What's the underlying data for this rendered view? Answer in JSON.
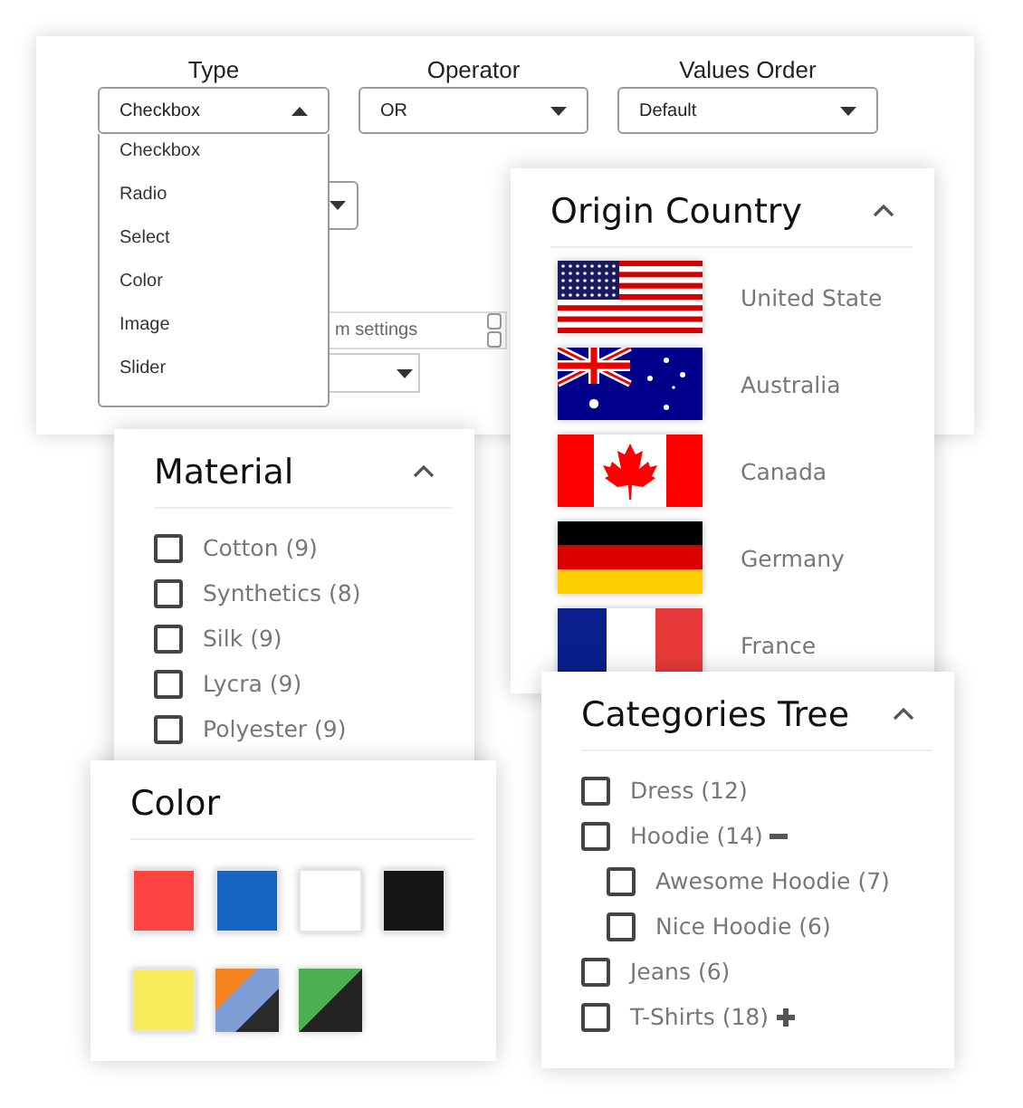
{
  "settings": {
    "fields": [
      {
        "label": "Type",
        "value": "Checkbox",
        "open": true,
        "options": [
          "Checkbox",
          "Radio",
          "Select",
          "Color",
          "Image",
          "Slider"
        ]
      },
      {
        "label": "Operator",
        "value": "OR",
        "open": false
      },
      {
        "label": "Values Order",
        "value": "Default",
        "open": false
      }
    ],
    "covered_fields": [
      {
        "kind": "select"
      },
      {
        "kind": "number",
        "placeholder": "m settings"
      },
      {
        "kind": "select"
      }
    ]
  },
  "filters": [
    {
      "kind": "flags",
      "title": "Origin Country",
      "expanded": true,
      "items": [
        {
          "label": "United State",
          "kind": "us"
        },
        {
          "label": "Australia",
          "kind": "au"
        },
        {
          "label": "Canada",
          "kind": "ca"
        },
        {
          "label": "Germany",
          "kind": "de"
        },
        {
          "label": "France",
          "kind": "fr"
        }
      ]
    },
    {
      "kind": "checkboxes",
      "title": "Material",
      "expanded": true,
      "items": [
        {
          "label": "Cotton (9)",
          "checked": false
        },
        {
          "label": "Synthetics (8)",
          "checked": false
        },
        {
          "label": "Silk (9)",
          "checked": false
        },
        {
          "label": "Lycra (9)",
          "checked": false
        },
        {
          "label": "Polyester (9)",
          "checked": false
        }
      ]
    },
    {
      "kind": "swatches",
      "title": "Color",
      "items": [
        {
          "bands": [
            {
              "color": "#ff4444"
            }
          ]
        },
        {
          "bands": [
            {
              "color": "#1565c0"
            }
          ]
        },
        {
          "bands": [
            {
              "color": "#ffffff"
            }
          ]
        },
        {
          "bands": [
            {
              "color": "#151515"
            }
          ]
        },
        {
          "bands": [
            {
              "color": "#f9ec5c"
            }
          ]
        },
        {
          "bands": [
            {
              "color": "#f5841f"
            },
            {
              "color": "#7f9ed6"
            },
            {
              "color": "#2a2a2a"
            }
          ]
        },
        {
          "bands": [
            {
              "color": "#4caf50"
            },
            {
              "color": "#232323"
            }
          ]
        }
      ]
    },
    {
      "kind": "tree",
      "title": "Categories Tree",
      "expanded": true,
      "items": [
        {
          "label": "Dress (12)",
          "checked": false
        },
        {
          "label": "Hoodie (14)",
          "checked": false,
          "expanded": true,
          "children": [
            {
              "label": "Awesome Hoodie (7)",
              "checked": false
            },
            {
              "label": "Nice Hoodie (6)",
              "checked": false
            }
          ]
        },
        {
          "label": "Jeans (6)",
          "checked": false
        },
        {
          "label": "T-Shirts (18)",
          "checked": false,
          "expanded": false
        }
      ]
    }
  ]
}
